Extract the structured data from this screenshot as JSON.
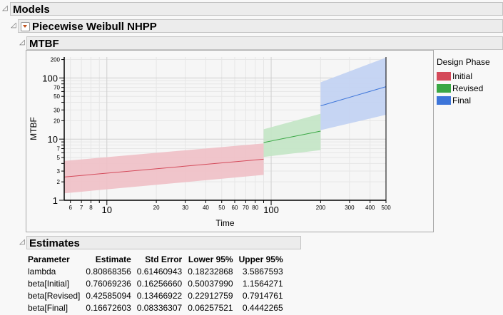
{
  "headers": {
    "models": "Models",
    "platform": "Piecewise Weibull NHPP",
    "mtbf": "MTBF",
    "estimates": "Estimates"
  },
  "chart_data": {
    "type": "line",
    "title": "MTBF",
    "xlabel": "Time",
    "ylabel": "MTBF",
    "xscale": "log",
    "yscale": "log",
    "xlim": [
      5.5,
      500
    ],
    "ylim": [
      1,
      220
    ],
    "xticks_major": [
      {
        "v": 10,
        "label": "10"
      },
      {
        "v": 100,
        "label": "100"
      }
    ],
    "xticks_minor": [
      {
        "v": 6,
        "label": "6"
      },
      {
        "v": 7,
        "label": "7"
      },
      {
        "v": 8,
        "label": "8"
      },
      {
        "v": 9,
        "label": ""
      },
      {
        "v": 20,
        "label": "20"
      },
      {
        "v": 30,
        "label": "30"
      },
      {
        "v": 40,
        "label": "40"
      },
      {
        "v": 50,
        "label": "50"
      },
      {
        "v": 60,
        "label": "60"
      },
      {
        "v": 70,
        "label": "70"
      },
      {
        "v": 80,
        "label": "80"
      },
      {
        "v": 90,
        "label": ""
      },
      {
        "v": 200,
        "label": "200"
      },
      {
        "v": 300,
        "label": "300"
      },
      {
        "v": 400,
        "label": "400"
      },
      {
        "v": 500,
        "label": "500"
      }
    ],
    "yticks_major": [
      {
        "v": 1,
        "label": "1"
      },
      {
        "v": 10,
        "label": "10"
      },
      {
        "v": 100,
        "label": "100"
      }
    ],
    "yticks_minor": [
      {
        "v": 2,
        "label": "2"
      },
      {
        "v": 3,
        "label": "3"
      },
      {
        "v": 4,
        "label": ""
      },
      {
        "v": 5,
        "label": "5"
      },
      {
        "v": 6,
        "label": ""
      },
      {
        "v": 7,
        "label": "7"
      },
      {
        "v": 8,
        "label": ""
      },
      {
        "v": 9,
        "label": ""
      },
      {
        "v": 20,
        "label": "20"
      },
      {
        "v": 30,
        "label": "30"
      },
      {
        "v": 40,
        "label": ""
      },
      {
        "v": 50,
        "label": "50"
      },
      {
        "v": 60,
        "label": ""
      },
      {
        "v": 70,
        "label": "70"
      },
      {
        "v": 80,
        "label": ""
      },
      {
        "v": 90,
        "label": ""
      },
      {
        "v": 200,
        "label": "200"
      }
    ],
    "legend_title": "Design Phase",
    "legend_position": "right",
    "series": [
      {
        "name": "Initial",
        "color": "#d44a5a",
        "band": "#f0c0c6",
        "x": [
          5.5,
          90
        ],
        "estimate": [
          2.4,
          4.7
        ],
        "lower": [
          1.3,
          2.6
        ],
        "upper": [
          4.4,
          8.5
        ]
      },
      {
        "name": "Revised",
        "color": "#3aa845",
        "band": "#c3e6c5",
        "x": [
          90,
          200
        ],
        "estimate": [
          8.8,
          13.5
        ],
        "lower": [
          5.1,
          6.6
        ],
        "upper": [
          14.5,
          26
        ]
      },
      {
        "name": "Final",
        "color": "#3d75d9",
        "band": "#c1d2f3",
        "x": [
          200,
          500
        ],
        "estimate": [
          35,
          72
        ],
        "lower": [
          14,
          25
        ],
        "upper": [
          85,
          215
        ]
      }
    ]
  },
  "estimates": {
    "columns": [
      "Parameter",
      "Estimate",
      "Std Error",
      "Lower 95%",
      "Upper 95%"
    ],
    "rows": [
      [
        "lambda",
        "0.80868356",
        "0.61460943",
        "0.18232868",
        "3.5867593"
      ],
      [
        "beta[Initial]",
        "0.76069236",
        "0.16256660",
        "0.50037990",
        "1.1564271"
      ],
      [
        "beta[Revised]",
        "0.42585094",
        "0.13466922",
        "0.22912759",
        "0.7914761"
      ],
      [
        "beta[Final]",
        "0.16672603",
        "0.08336307",
        "0.06257521",
        "0.4442265"
      ]
    ]
  }
}
